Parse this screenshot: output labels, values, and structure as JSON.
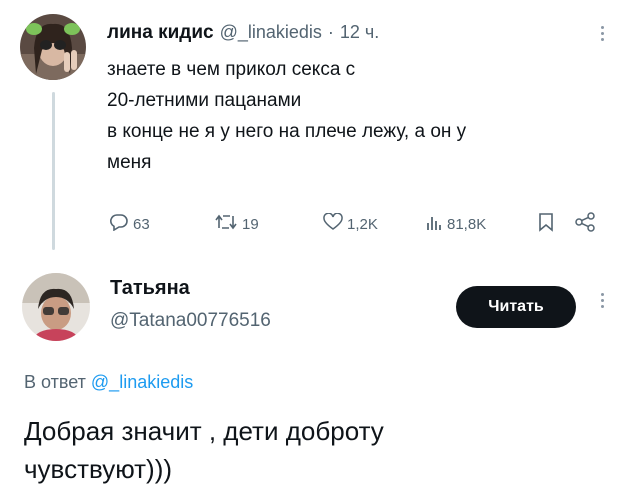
{
  "tweet": {
    "author_name": "лина кидис",
    "handle": "@_linakiedis",
    "separator": "·",
    "time": "12 ч.",
    "lines": [
      "знаете в чем прикол секса с",
      "20-летними пацанами",
      "в конце не я у него на плече лежу, а он у",
      "меня"
    ],
    "actions": {
      "replies": "63",
      "retweets": "19",
      "likes": "1,2K",
      "views": "81,8K"
    }
  },
  "reply": {
    "author_name": "Татьяна",
    "handle": "@Tatana00776516",
    "follow_label": "Читать",
    "reply_to_prefix": "В ответ",
    "reply_to_handle": "@_linakiedis",
    "lines": [
      "Добрая значит , дети доброту",
      "чувствуют)))"
    ]
  },
  "colors": {
    "text": "#0f1419",
    "muted": "#536471",
    "link": "#1d9bf0",
    "thread_line": "#cfd9de",
    "button_bg": "#0f1419"
  },
  "icons": [
    "reply-icon",
    "retweet-icon",
    "like-icon",
    "views-icon",
    "bookmark-icon",
    "share-icon",
    "more-icon"
  ]
}
